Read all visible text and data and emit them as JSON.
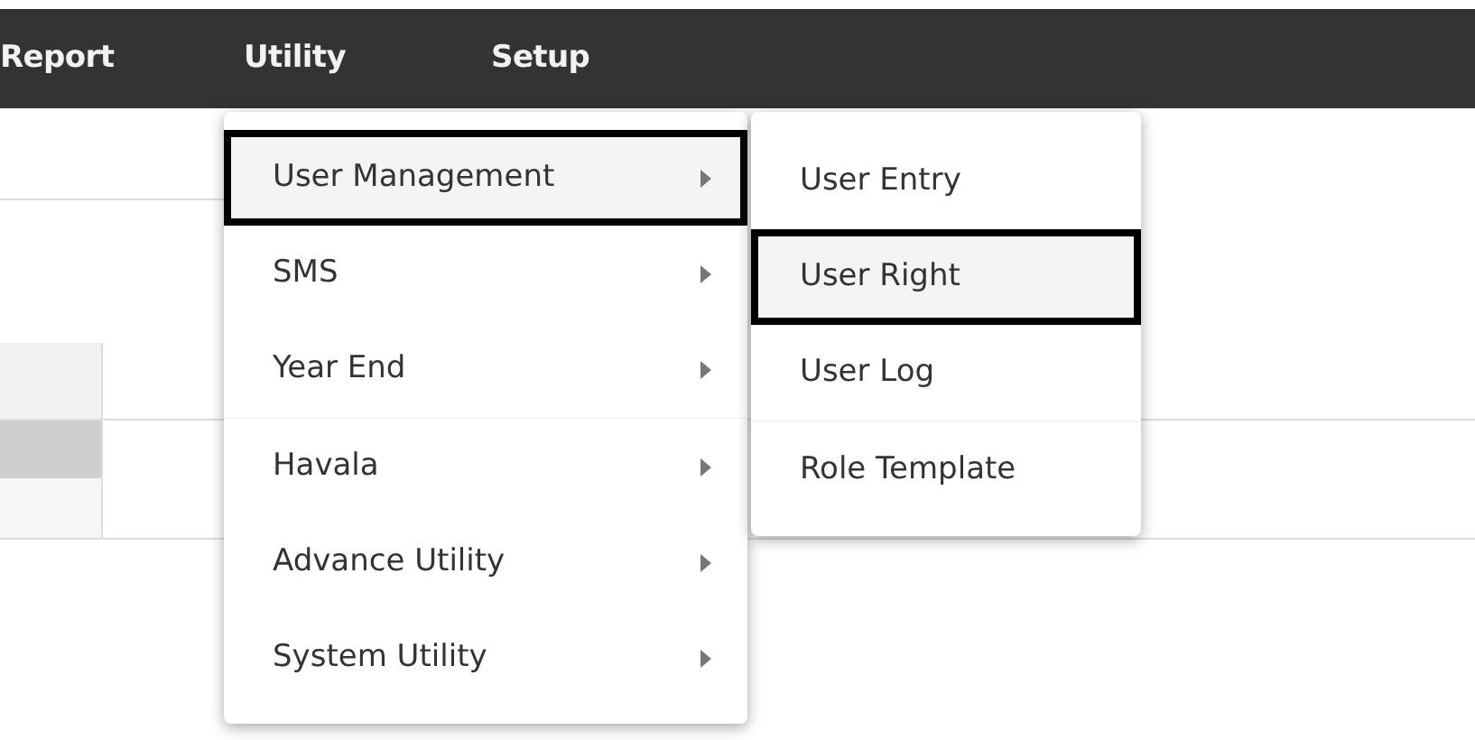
{
  "menubar": [
    {
      "label": "Report"
    },
    {
      "label": "Utility"
    },
    {
      "label": "Setup"
    }
  ],
  "menu": {
    "groups": [
      [
        {
          "label": "User Management",
          "submenu": true,
          "highlighted": true
        },
        {
          "label": "SMS",
          "submenu": true,
          "highlighted": false
        },
        {
          "label": "Year End",
          "submenu": true,
          "highlighted": false
        }
      ],
      [
        {
          "label": "Havala",
          "submenu": true,
          "highlighted": false
        },
        {
          "label": "Advance Utility",
          "submenu": true,
          "highlighted": false
        },
        {
          "label": "System Utility",
          "submenu": true,
          "highlighted": false
        }
      ]
    ]
  },
  "submenu": {
    "groups": [
      [
        {
          "label": "User Entry",
          "highlighted": false
        },
        {
          "label": "User Right",
          "highlighted": true
        },
        {
          "label": "User Log",
          "highlighted": false
        }
      ],
      [
        {
          "label": "Role Template",
          "highlighted": false
        }
      ]
    ]
  }
}
